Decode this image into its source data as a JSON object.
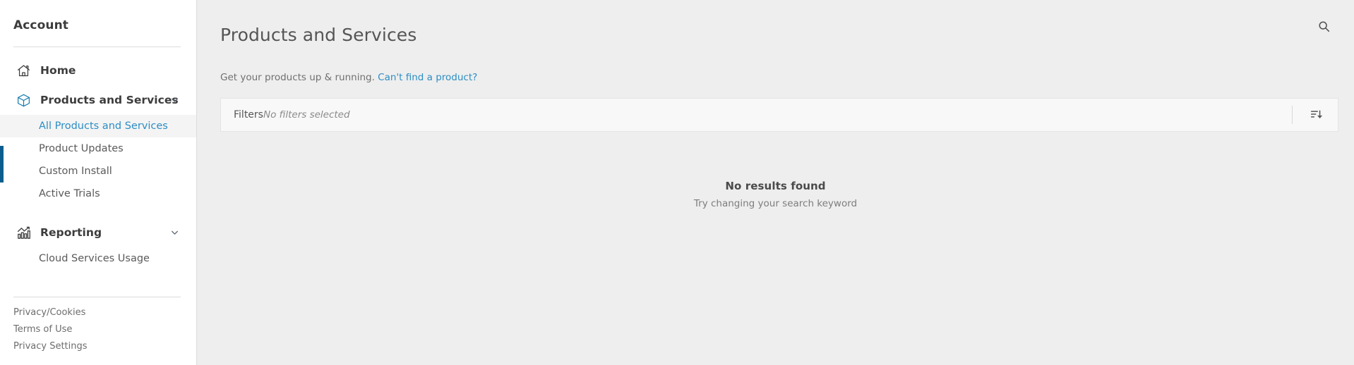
{
  "sidebar": {
    "account_label": "Account",
    "nav": [
      {
        "label": "Home",
        "icon": "home-icon",
        "expandable": false
      },
      {
        "label": "Products and Services",
        "icon": "cube-icon",
        "expandable": true
      },
      {
        "label": "Reporting",
        "icon": "bar-chart-icon",
        "expandable": true
      }
    ],
    "products_subitems": [
      {
        "label": "All Products and Services",
        "selected": true
      },
      {
        "label": "Product Updates",
        "selected": false
      },
      {
        "label": "Custom Install",
        "selected": false
      },
      {
        "label": "Active Trials",
        "selected": false
      }
    ],
    "reporting_subitems": [
      {
        "label": "Cloud Services Usage",
        "selected": false
      }
    ],
    "footer_links": [
      "Privacy/Cookies",
      "Terms of Use",
      "Privacy Settings"
    ]
  },
  "main": {
    "title": "Products and Services",
    "subtitle_text": "Get your products up & running.",
    "subtitle_link": "Can't find a product?",
    "search_icon": "search-icon",
    "filters": {
      "label": "Filters",
      "value": "No filters selected",
      "sort_icon": "sort-descending-icon"
    },
    "empty_state": {
      "title": "No results found",
      "subtitle": "Try changing your search keyword"
    }
  },
  "colors": {
    "accent_blue": "#2c8ec4",
    "marker_blue": "#0b5d8f",
    "page_bg": "#eeeeee",
    "panel_bg": "#f8f8f8",
    "sidebar_bg": "#ffffff",
    "text_primary": "#4a4a4a",
    "text_muted": "#7d7d7d"
  }
}
